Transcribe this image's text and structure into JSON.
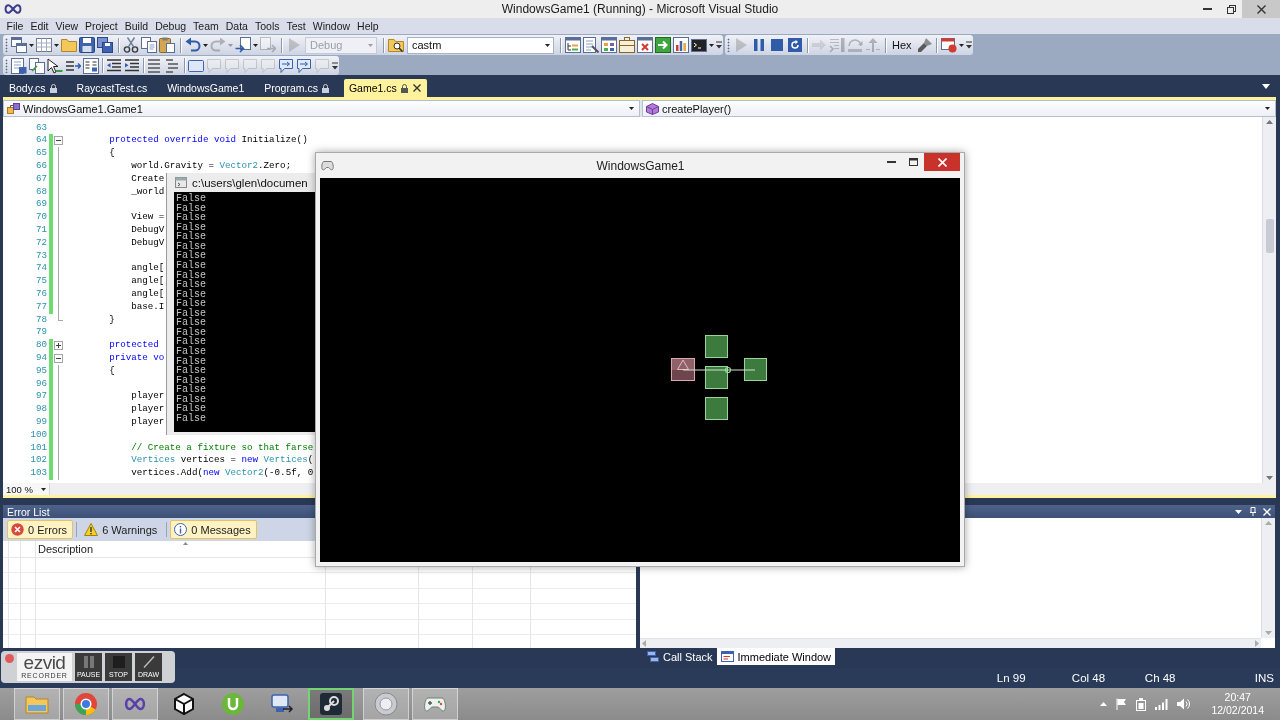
{
  "window": {
    "title": "WindowsGame1 (Running) - Microsoft Visual Studio"
  },
  "menu": [
    "File",
    "Edit",
    "View",
    "Project",
    "Build",
    "Debug",
    "Team",
    "Data",
    "Tools",
    "Test",
    "Window",
    "Help"
  ],
  "toolbar_rows": [
    [
      {
        "groups": [
          [
            {
              "kind": "split",
              "disabled": false
            },
            {
              "kind": "split",
              "disabled": false
            },
            {
              "kind": "button",
              "disabled": false
            },
            {
              "kind": "button",
              "disabled": false
            },
            {
              "kind": "button",
              "disabled": false
            }
          ],
          [
            {
              "kind": "button",
              "disabled": false
            },
            {
              "kind": "button",
              "disabled": false
            },
            {
              "kind": "button",
              "disabled": false
            }
          ],
          [
            {
              "kind": "split",
              "disabled": false
            },
            {
              "kind": "split",
              "disabled": true
            },
            {
              "kind": "split",
              "disabled": false
            },
            {
              "kind": "button",
              "disabled": true
            }
          ],
          [
            {
              "kind": "button",
              "disabled": true
            },
            {
              "kind": "combo",
              "value": "Debug",
              "disabled": true
            }
          ],
          [
            {
              "kind": "button",
              "disabled": false
            },
            {
              "kind": "combo",
              "value": "castm",
              "disabled": false
            }
          ],
          [
            {
              "kind": "button",
              "disabled": false
            },
            {
              "kind": "button",
              "disabled": false
            },
            {
              "kind": "button",
              "disabled": false
            },
            {
              "kind": "button",
              "disabled": false
            },
            {
              "kind": "button",
              "disabled": false
            },
            {
              "kind": "button",
              "disabled": false
            },
            {
              "kind": "button",
              "disabled": false
            },
            {
              "kind": "split",
              "disabled": false
            }
          ]
        ]
      },
      {
        "groups": [
          [
            {
              "kind": "button",
              "disabled": true
            },
            {
              "kind": "button",
              "disabled": false
            },
            {
              "kind": "button",
              "disabled": false
            },
            {
              "kind": "button",
              "disabled": false
            }
          ],
          [
            {
              "kind": "button",
              "disabled": true
            },
            {
              "kind": "button",
              "disabled": true
            },
            {
              "kind": "button",
              "disabled": true
            },
            {
              "kind": "button",
              "disabled": true
            }
          ],
          [
            {
              "kind": "text",
              "label": "Hex",
              "disabled": false
            },
            {
              "kind": "button",
              "disabled": false
            }
          ],
          [
            {
              "kind": "split",
              "disabled": false
            }
          ]
        ]
      }
    ],
    [
      {
        "groups": [
          [
            {
              "kind": "button",
              "disabled": false
            },
            {
              "kind": "button",
              "disabled": false
            },
            {
              "kind": "button",
              "disabled": false
            },
            {
              "kind": "button",
              "disabled": false
            },
            {
              "kind": "button",
              "disabled": false
            }
          ],
          [
            {
              "kind": "button",
              "disabled": false
            },
            {
              "kind": "button",
              "disabled": false
            }
          ],
          [
            {
              "kind": "button",
              "disabled": false
            },
            {
              "kind": "button",
              "disabled": false
            }
          ],
          [
            {
              "kind": "button",
              "disabled": false
            },
            {
              "kind": "button",
              "disabled": true
            },
            {
              "kind": "button",
              "disabled": true
            },
            {
              "kind": "button",
              "disabled": true
            },
            {
              "kind": "button",
              "disabled": true
            },
            {
              "kind": "button",
              "disabled": false
            },
            {
              "kind": "button",
              "disabled": false
            },
            {
              "kind": "button",
              "disabled": true
            }
          ]
        ]
      }
    ]
  ],
  "doc_tabs": [
    {
      "label": "Body.cs",
      "locked": true,
      "selected": false
    },
    {
      "label": "RaycastTest.cs",
      "locked": false,
      "selected": false
    },
    {
      "label": "WindowsGame1",
      "locked": false,
      "selected": false
    },
    {
      "label": "Program.cs",
      "locked": true,
      "selected": false
    },
    {
      "label": "Game1.cs",
      "locked": true,
      "selected": true
    }
  ],
  "navigation": {
    "type": "WindowsGame1.Game1",
    "member": "createPlayer()"
  },
  "editor": {
    "lines": [
      {
        "number": "63",
        "changed": false
      },
      {
        "number": "64",
        "changed": true,
        "expanded": true,
        "tokens": [
          {
            "text": "        protected override void",
            "kind": "keyword"
          },
          {
            "text": " Initialize()",
            "kind": "plain"
          }
        ]
      },
      {
        "number": "65",
        "changed": true,
        "guide": true,
        "tokens": [
          {
            "text": "        {",
            "kind": "plain"
          }
        ]
      },
      {
        "number": "66",
        "changed": true,
        "guide": true,
        "tokens": [
          {
            "text": "            world.Gravity = ",
            "kind": "plain"
          },
          {
            "text": "Vector2",
            "kind": "type"
          },
          {
            "text": ".Zero;",
            "kind": "plain"
          }
        ]
      },
      {
        "number": "67",
        "changed": true,
        "guide": true,
        "tokens": [
          {
            "text": "            Create",
            "kind": "plain"
          }
        ]
      },
      {
        "number": "68",
        "changed": true,
        "guide": true,
        "tokens": [
          {
            "text": "            _world",
            "kind": "plain"
          }
        ]
      },
      {
        "number": "69",
        "changed": true,
        "guide": true
      },
      {
        "number": "70",
        "changed": true,
        "guide": true,
        "tokens": [
          {
            "text": "            View =",
            "kind": "plain"
          }
        ]
      },
      {
        "number": "71",
        "changed": true,
        "guide": true,
        "tokens": [
          {
            "text": "            DebugV",
            "kind": "plain"
          }
        ]
      },
      {
        "number": "72",
        "changed": true,
        "guide": true,
        "tokens": [
          {
            "text": "            DebugV",
            "kind": "plain"
          }
        ]
      },
      {
        "number": "73",
        "changed": true,
        "guide": true
      },
      {
        "number": "74",
        "changed": true,
        "guide": true,
        "tokens": [
          {
            "text": "            angle[",
            "kind": "plain"
          }
        ]
      },
      {
        "number": "75",
        "changed": true,
        "guide": true,
        "tokens": [
          {
            "text": "            angle[",
            "kind": "plain"
          }
        ]
      },
      {
        "number": "76",
        "changed": true,
        "guide": true,
        "tokens": [
          {
            "text": "            angle[",
            "kind": "plain"
          }
        ]
      },
      {
        "number": "77",
        "changed": true,
        "guide": true,
        "tokens": [
          {
            "text": "            base.I",
            "kind": "plain"
          }
        ]
      },
      {
        "number": "78",
        "changed": false,
        "guide_end": true,
        "tokens": [
          {
            "text": "        }",
            "kind": "plain"
          }
        ]
      },
      {
        "number": "79",
        "changed": false
      },
      {
        "number": "80",
        "changed": true,
        "expanded": false,
        "tokens": [
          {
            "text": "        protected",
            "kind": "keyword"
          }
        ]
      },
      {
        "number": "94",
        "changed": true,
        "expanded": true,
        "tokens": [
          {
            "text": "        private vo",
            "kind": "keyword"
          }
        ]
      },
      {
        "number": "95",
        "changed": true,
        "guide": true,
        "tokens": [
          {
            "text": "        {",
            "kind": "plain"
          }
        ]
      },
      {
        "number": "96",
        "changed": true,
        "guide": true
      },
      {
        "number": "97",
        "changed": true,
        "guide": true,
        "tokens": [
          {
            "text": "            player",
            "kind": "plain"
          }
        ]
      },
      {
        "number": "98",
        "changed": true,
        "guide": true,
        "tokens": [
          {
            "text": "            player",
            "kind": "plain"
          }
        ]
      },
      {
        "number": "99",
        "changed": true,
        "guide": true,
        "tokens": [
          {
            "text": "            player",
            "kind": "plain"
          }
        ]
      },
      {
        "number": "100",
        "changed": true,
        "guide": true
      },
      {
        "number": "101",
        "changed": true,
        "guide": true,
        "tokens": [
          {
            "text": "            // Create a fixture so that farse",
            "kind": "comment"
          }
        ]
      },
      {
        "number": "102",
        "changed": true,
        "guide": true,
        "tokens": [
          {
            "text": "            Vertices",
            "kind": "type"
          },
          {
            "text": " vertices = ",
            "kind": "plain"
          },
          {
            "text": "new",
            "kind": "keyword"
          },
          {
            "text": " Vertices",
            "kind": "type"
          },
          {
            "text": "(",
            "kind": "plain"
          }
        ]
      },
      {
        "number": "103",
        "changed": true,
        "guide": true,
        "tokens": [
          {
            "text": "            vertices.Add(",
            "kind": "plain"
          },
          {
            "text": "new",
            "kind": "keyword"
          },
          {
            "text": " Vector2",
            "kind": "type"
          },
          {
            "text": "(-0.5f, 0",
            "kind": "plain"
          }
        ]
      }
    ],
    "zoom": "100 %"
  },
  "console_window": {
    "title": "c:\\users\\glen\\documen",
    "lines": [
      "False",
      "False",
      "False",
      "False",
      "False",
      "False",
      "False",
      "False",
      "False",
      "False",
      "False",
      "False",
      "False",
      "False",
      "False",
      "False",
      "False",
      "False",
      "False",
      "False",
      "False",
      "False",
      "False",
      "False"
    ]
  },
  "game_window": {
    "title": "WindowsGame1"
  },
  "error_list": {
    "title": "Error List",
    "filters": [
      {
        "label": "0 Errors",
        "kind": "error",
        "selected": true
      },
      {
        "label": "6 Warnings",
        "kind": "warning",
        "selected": false
      },
      {
        "label": "0 Messages",
        "kind": "message",
        "selected": true
      }
    ],
    "columns": [
      "Description"
    ]
  },
  "tool_tabs": [
    {
      "label": "Call Stack",
      "selected": false
    },
    {
      "label": "Immediate Window",
      "selected": true
    }
  ],
  "status_bar": {
    "line": "Ln 99",
    "column": "Col 48",
    "character": "Ch 48",
    "mode": "INS"
  },
  "recorder": {
    "logo": "ezvid",
    "sublabel": "RECORDER",
    "buttons": [
      "PAUSE",
      "STOP",
      "DRAW"
    ]
  },
  "taskbar": {
    "apps": [
      {
        "running": true,
        "highlighted": false
      },
      {
        "running": true,
        "highlighted": false
      },
      {
        "running": true,
        "highlighted": false
      },
      {
        "running": false,
        "highlighted": false
      },
      {
        "running": false,
        "highlighted": false
      },
      {
        "running": false,
        "highlighted": false
      },
      {
        "running": false,
        "highlighted": true
      },
      {
        "running": true,
        "highlighted": false
      },
      {
        "running": true,
        "highlighted": false
      }
    ],
    "clock": {
      "time": "20:47",
      "date": "12/02/2014"
    }
  }
}
